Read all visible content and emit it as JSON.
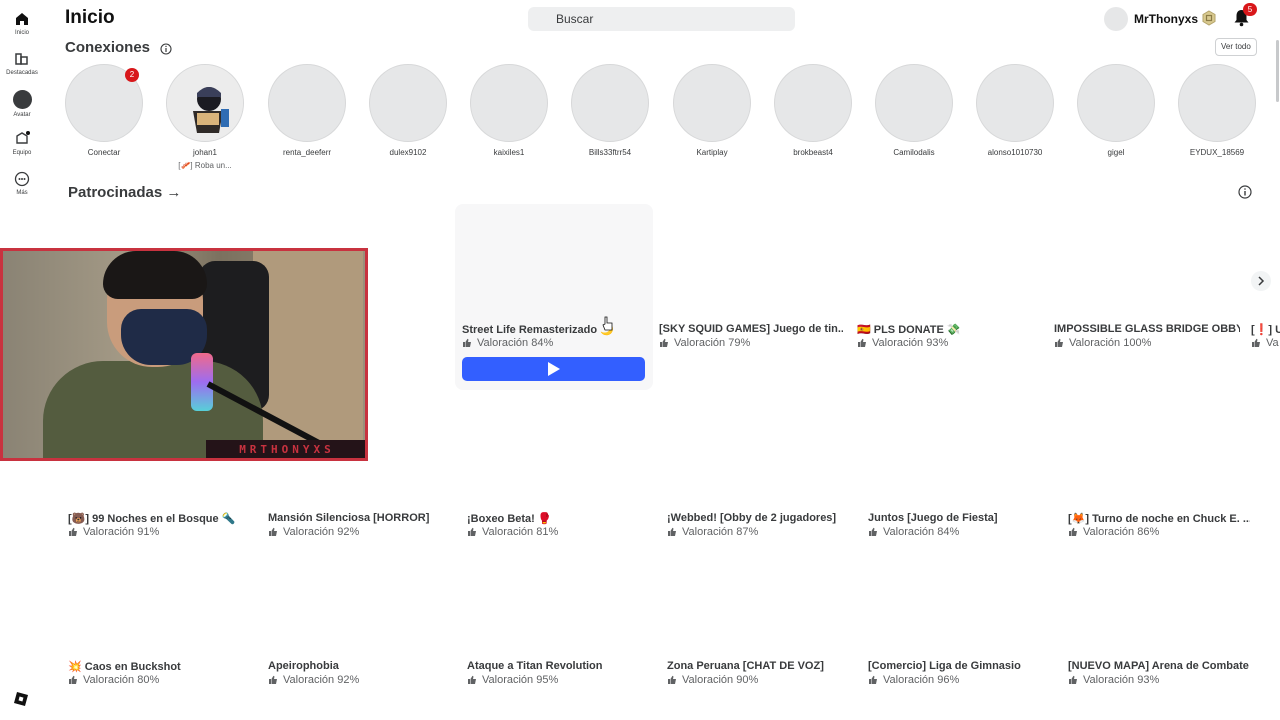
{
  "rail": {
    "items": [
      {
        "label": "Inicio",
        "icon": "home-icon"
      },
      {
        "label": "Destacadas",
        "icon": "charts-icon"
      },
      {
        "label": "Avatar",
        "icon": "avatar-icon"
      },
      {
        "label": "Equipo",
        "icon": "inventory-icon"
      },
      {
        "label": "Más",
        "icon": "more-icon"
      }
    ]
  },
  "header": {
    "title": "Inicio",
    "search_placeholder": "Buscar",
    "username": "MrThonyxs",
    "notifications_count": "5"
  },
  "connections": {
    "title": "Conexiones",
    "see_all": "Ver todo",
    "connect_badge": "2",
    "friends": [
      {
        "name": "Conectar",
        "status": ""
      },
      {
        "name": "johan1",
        "status": "[🥓] Roba un..."
      },
      {
        "name": "renta_deeferr",
        "status": ""
      },
      {
        "name": "dulex9102",
        "status": ""
      },
      {
        "name": "kaixiles1",
        "status": ""
      },
      {
        "name": "Bills33ftrr54",
        "status": ""
      },
      {
        "name": "Kartiplay",
        "status": ""
      },
      {
        "name": "brokbeast4",
        "status": ""
      },
      {
        "name": "Camilodalis",
        "status": ""
      },
      {
        "name": "alonso1010730",
        "status": ""
      },
      {
        "name": "gigel",
        "status": ""
      },
      {
        "name": "EYDUX_18569",
        "status": ""
      }
    ]
  },
  "sponsored": {
    "title": "Patrocinadas →",
    "games": [
      {
        "title": "Street Life Remasterizado 🌙",
        "rating": "Valoración 84%"
      },
      {
        "title": "[SKY SQUID GAMES] Juego de tin...",
        "rating": "Valoración 79%"
      },
      {
        "title": "🇪🇸 PLS DONATE 💸",
        "rating": "Valoración 93%"
      },
      {
        "title": "IMPOSSIBLE GLASS BRIDGE OBBY",
        "rating": "Valoración 100%"
      },
      {
        "title": "[❗] UI",
        "rating": "Va"
      }
    ]
  },
  "games_row1": [
    {
      "title": "[🐻] 99 Noches en el Bosque 🔦",
      "rating": "Valoración 91%"
    },
    {
      "title": "Mansión Silenciosa [HORROR]",
      "rating": "Valoración 92%"
    },
    {
      "title": "¡Boxeo Beta! 🥊",
      "rating": "Valoración 81%"
    },
    {
      "title": "¡Webbed! [Obby de 2 jugadores]",
      "rating": "Valoración 87%"
    },
    {
      "title": "Juntos [Juego de Fiesta]",
      "rating": "Valoración 84%"
    },
    {
      "title": "[🦊] Turno de noche en Chuck E. ...",
      "rating": "Valoración 86%"
    }
  ],
  "games_row2": [
    {
      "title": "💥 Caos en Buckshot",
      "rating": "Valoración 80%"
    },
    {
      "title": "Apeirophobia",
      "rating": "Valoración 92%"
    },
    {
      "title": "Ataque a Titan Revolution",
      "rating": "Valoración 95%"
    },
    {
      "title": "Zona Peruana [CHAT DE VOZ]",
      "rating": "Valoración 90%"
    },
    {
      "title": "[Comercio] Liga de Gimnasio",
      "rating": "Valoración 96%"
    },
    {
      "title": "[NUEVO MAPA] Arena de Combate",
      "rating": "Valoración 93%"
    }
  ],
  "webcam": {
    "overlay_name": "MRTHONYXS"
  },
  "colors": {
    "accent_blue": "#335fff",
    "badge_red": "#d8171a",
    "webcam_border": "#c8323f"
  }
}
